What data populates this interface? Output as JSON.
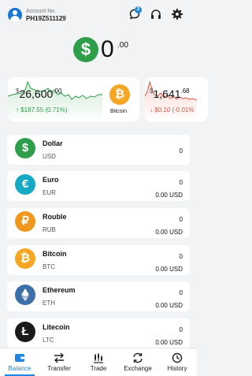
{
  "header": {
    "account_label": "Account No.",
    "account_number": "PH19Z511129",
    "notification_count": "2"
  },
  "total": {
    "currency_symbol": "$",
    "integer": "0",
    "decimal": ".00"
  },
  "tickers": [
    {
      "currency": "$",
      "price_int": "26,600",
      "price_dec": ".00",
      "change": "↑ $187.55 (0.71%)",
      "coin_symbol": "₿",
      "coin_name": "Bitcoin",
      "trend": "up"
    },
    {
      "currency": "$",
      "price_int": "1,641",
      "price_dec": ".68",
      "change": "↓ $0.10 (-0.01%",
      "trend": "down"
    }
  ],
  "assets": [
    {
      "name": "Dollar",
      "code": "USD",
      "amount": "0",
      "usd": "",
      "symbol": "$",
      "color": "#2e9e4a"
    },
    {
      "name": "Euro",
      "code": "EUR",
      "amount": "0",
      "usd": "0.00 USD",
      "symbol": "€",
      "color": "#16a9c4"
    },
    {
      "name": "Rouble",
      "code": "RUB",
      "amount": "0",
      "usd": "0.00 USD",
      "symbol": "₽",
      "color": "#f0961d"
    },
    {
      "name": "Bitcoin",
      "code": "BTC",
      "amount": "0",
      "usd": "0.00 USD",
      "symbol": "₿",
      "color": "#f5a623"
    },
    {
      "name": "Ethereum",
      "code": "ETH",
      "amount": "0",
      "usd": "0.00 USD",
      "symbol": "◆",
      "color": "#3d6fa8"
    },
    {
      "name": "Litecoin",
      "code": "LTC",
      "amount": "0",
      "usd": "0.00 USD",
      "symbol": "Ł",
      "color": "#1b1b1b"
    }
  ],
  "nav": [
    "Balance",
    "Transfer",
    "Trade",
    "Exchange",
    "History"
  ],
  "colors": {
    "accent": "#1e88e5",
    "positive": "#2e9e4a",
    "negative": "#e05540"
  }
}
